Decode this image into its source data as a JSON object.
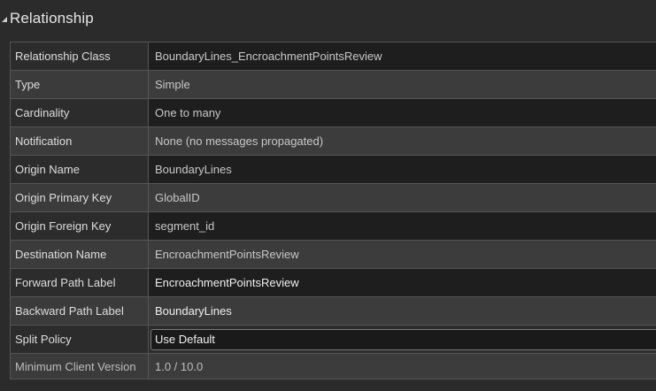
{
  "section": {
    "title": "Relationship",
    "collapse_icon": "chevron-down-icon"
  },
  "rows": [
    {
      "label": "Relationship Class",
      "value": "BoundaryLines_EncroachmentPointsReview"
    },
    {
      "label": "Type",
      "value": "Simple"
    },
    {
      "label": "Cardinality",
      "value": "One to many"
    },
    {
      "label": "Notification",
      "value": "None (no messages propagated)"
    },
    {
      "label": "Origin Name",
      "value": "BoundaryLines"
    },
    {
      "label": "Origin Primary Key",
      "value": "GlobalID"
    },
    {
      "label": "Origin Foreign Key",
      "value": "segment_id"
    },
    {
      "label": "Destination Name",
      "value": "EncroachmentPointsReview"
    },
    {
      "label": "Forward Path Label",
      "value": "EncroachmentPointsReview"
    },
    {
      "label": "Backward Path Label",
      "value": "BoundaryLines"
    },
    {
      "label": "Split Policy",
      "value": "Use Default"
    },
    {
      "label": "Minimum Client Version",
      "value": "1.0 / 10.0"
    }
  ],
  "colors": {
    "background": "#2b2b2b",
    "grid_line": "#555555",
    "text": "#dcdcdc"
  }
}
